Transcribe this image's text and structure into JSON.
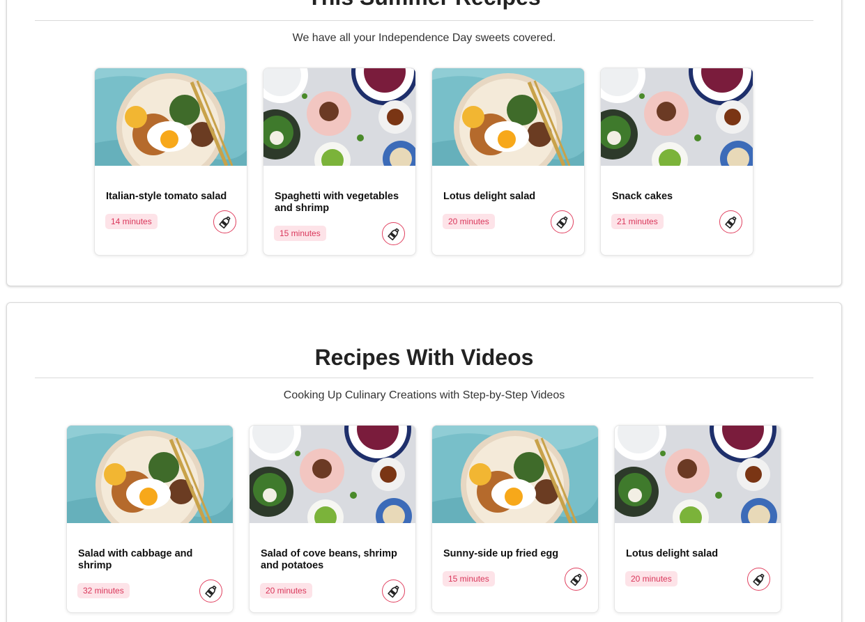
{
  "section1": {
    "title": "This Summer Recipes",
    "subtitle": "We have all your Independence Day sweets covered.",
    "cards": [
      {
        "title": "Italian-style tomato salad",
        "time": "14 minutes",
        "image": "egg-bowl"
      },
      {
        "title": "Spaghetti with vegetables and shrimp",
        "time": "15 minutes",
        "image": "plates-spread"
      },
      {
        "title": "Lotus delight salad",
        "time": "20 minutes",
        "image": "egg-bowl"
      },
      {
        "title": "Snack cakes",
        "time": "21 minutes",
        "image": "plates-spread"
      }
    ]
  },
  "section2": {
    "title": "Recipes With Videos",
    "subtitle": "Cooking Up Culinary Creations with Step-by-Step Videos",
    "cards": [
      {
        "title": "Salad with cabbage and shrimp",
        "time": "32 minutes",
        "image": "egg-bowl"
      },
      {
        "title": "Salad of cove beans, shrimp and potatoes",
        "time": "20 minutes",
        "image": "plates-spread"
      },
      {
        "title": "Sunny-side up fried egg",
        "time": "15 minutes",
        "image": "egg-bowl"
      },
      {
        "title": "Lotus delight salad",
        "time": "20 minutes",
        "image": "plates-spread"
      }
    ]
  },
  "icons": {
    "favorite": "sauce-bottle-icon"
  },
  "colors": {
    "accent": "#e0405f",
    "pill_bg": "#fde3e8",
    "pill_text": "#d9365a"
  }
}
